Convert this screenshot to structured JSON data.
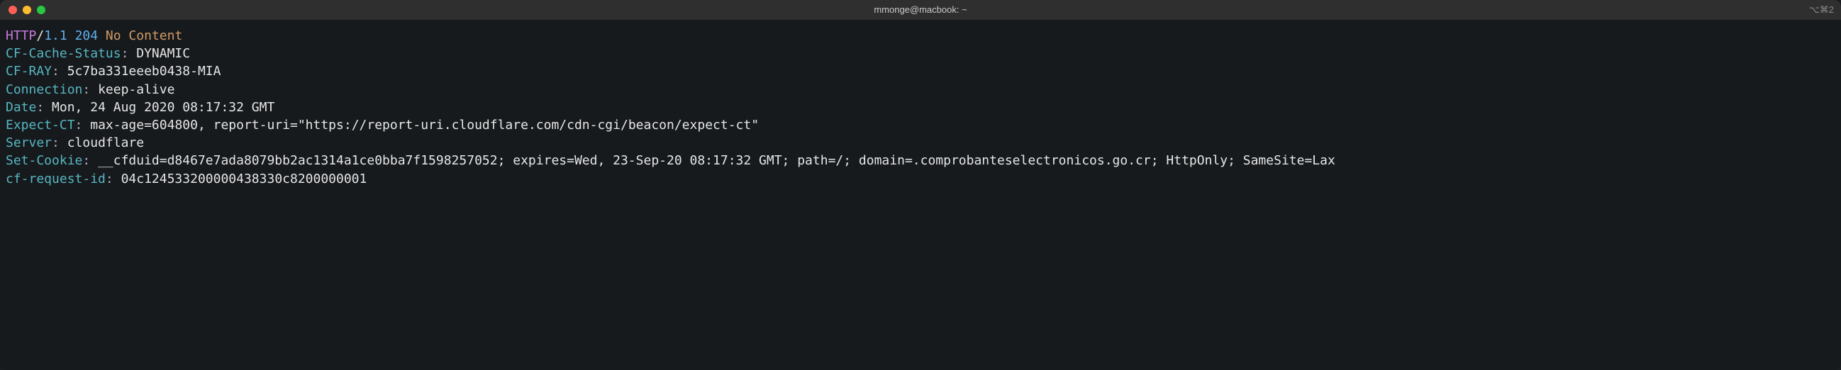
{
  "window": {
    "title": "mmonge@macbook: ~",
    "session_indicator": "⌥⌘2"
  },
  "status_line": {
    "protocol": "HTTP",
    "slash": "/",
    "version": "1.1",
    "code": "204",
    "reason": "No Content"
  },
  "headers": [
    {
      "name": "CF-Cache-Status",
      "value": "DYNAMIC"
    },
    {
      "name": "CF-RAY",
      "value": "5c7ba331eeeb0438-MIA"
    },
    {
      "name": "Connection",
      "value": "keep-alive"
    },
    {
      "name": "Date",
      "value": "Mon, 24 Aug 2020 08:17:32 GMT"
    },
    {
      "name": "Expect-CT",
      "value": "max-age=604800, report-uri=\"https://report-uri.cloudflare.com/cdn-cgi/beacon/expect-ct\""
    },
    {
      "name": "Server",
      "value": "cloudflare"
    },
    {
      "name": "Set-Cookie",
      "value": "__cfduid=d8467e7ada8079bb2ac1314a1ce0bba7f1598257052; expires=Wed, 23-Sep-20 08:17:32 GMT; path=/; domain=.comprobanteselectronicos.go.cr; HttpOnly; SameSite=Lax"
    },
    {
      "name": "cf-request-id",
      "value": "04c124533200000438330c8200000001"
    }
  ]
}
